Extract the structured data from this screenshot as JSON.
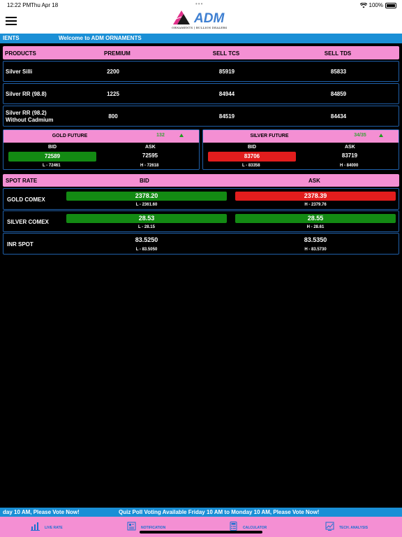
{
  "status": {
    "time": "12:22 PM",
    "date": "Thu Apr 18",
    "battery": "100%"
  },
  "brand": {
    "name": "ADM",
    "tagline": "ORNAMENTS | BULLION DEALERS"
  },
  "ticker_top": {
    "left_text": "IENTS",
    "center_text": "Welcome to ADM ORNAMENTS"
  },
  "products": {
    "headers": [
      "PRODUCTS",
      "PREMIUM",
      "SELL TCS",
      "SELL TDS"
    ],
    "rows": [
      {
        "name": "Silver Silli",
        "name2": "",
        "premium": "2200",
        "sell_tcs": "85919",
        "sell_tds": "85833"
      },
      {
        "name": "Silver  RR  (98.8)",
        "name2": "",
        "premium": "1225",
        "sell_tcs": "84944",
        "sell_tds": "84859"
      },
      {
        "name": "Silver  RR (98.2)",
        "name2": "Without  Cadmium",
        "premium": "800",
        "sell_tcs": "84519",
        "sell_tds": "84434"
      }
    ]
  },
  "gold_future": {
    "title": "GOLD FUTURE",
    "change": "132",
    "bid_label": "BID",
    "ask_label": "ASK",
    "bid": "72589",
    "ask": "72595",
    "low": "L - 72461",
    "high": "H - 72618",
    "bid_color": "#138a13"
  },
  "silver_future": {
    "title": "SILVER FUTURE",
    "change": "34/35",
    "bid_label": "BID",
    "ask_label": "ASK",
    "bid": "83706",
    "ask": "83719",
    "low": "L - 83358",
    "high": "H - 84000",
    "bid_color": "#e21d1d"
  },
  "spot": {
    "headers": [
      "SPOT RATE",
      "BID",
      "ASK"
    ],
    "rows": [
      {
        "name": "GOLD COMEX",
        "bid": "2378.20",
        "ask": "2378.39",
        "low": "L - 2361.60",
        "high": "H - 2379.76"
      },
      {
        "name": "SILVER COMEX",
        "bid": "28.53",
        "ask": "28.55",
        "low": "L - 28.15",
        "high": "H - 28.61"
      },
      {
        "name": "INR SPOT",
        "bid": "83.5250",
        "ask": "83.5350",
        "low": "L - 83.5050",
        "high": "H - 83.5730"
      }
    ]
  },
  "ticker_bottom": {
    "left_text": "day 10 AM, Please Vote Now!",
    "center_text": "Quiz Poll Voting Available Friday 10 AM to Monday 10 AM, Please Vote Now!"
  },
  "tabs": [
    {
      "label": "LIVE RATE",
      "icon": "chart-icon"
    },
    {
      "label": "NOTIFICATION",
      "icon": "newspaper-icon"
    },
    {
      "label": "CALCULATOR",
      "icon": "calculator-icon"
    },
    {
      "label": "TECH. ANALYSIS",
      "icon": "analysis-icon"
    }
  ],
  "colors": {
    "accent_pink": "#f48fd3",
    "ticker_blue": "#1a8fd6",
    "up_green": "#138a13",
    "down_red": "#e21d1d",
    "tab_blue": "#1a6fd1"
  }
}
